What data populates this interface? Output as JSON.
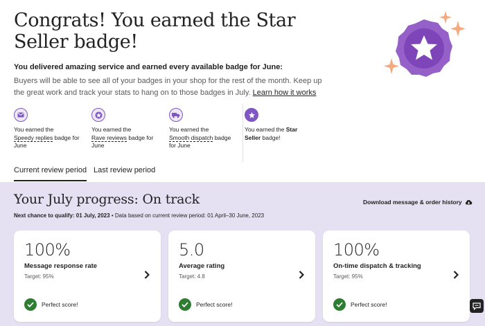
{
  "header": {
    "title": "Congrats! You earned the Star Seller badge!",
    "subhead": "You delivered amazing service and earned every available badge for June:",
    "body": "Buyers will be able to see all of your badges in your shop for the rest of the month. Keep up the great work and track your stats to hang on to those badges in July.",
    "learn_link": "Learn how it works"
  },
  "badges": [
    {
      "pre": "You earned the",
      "name": "Speedy replies",
      "post": "badge for June",
      "icon": "envelope-icon"
    },
    {
      "pre": "You earned the",
      "name": "Rave reviews",
      "post": "badge for June",
      "icon": "rave-reviews-icon"
    },
    {
      "pre": "You earned the",
      "name": "Smooth dispatch",
      "post": "badge for June",
      "icon": "truck-icon"
    }
  ],
  "star_badge": {
    "pre": "You earned the",
    "name": "Star Seller",
    "post": "badge!",
    "icon": "star-icon"
  },
  "tabs": [
    {
      "label": "Current review period",
      "active": true
    },
    {
      "label": "Last review period",
      "active": false
    }
  ],
  "progress": {
    "title": "Your July progress: On track",
    "download": "Download message & order history",
    "qualify_label": "Next chance to qualify: 01 July, 2023",
    "qualify_detail": "Data based on current review period: 01 April–30 June, 2023"
  },
  "cards": [
    {
      "value": "100%",
      "label": "Message response rate",
      "target": "Target: 95%",
      "score": "Perfect score!"
    },
    {
      "value": "5.0",
      "label": "Average rating",
      "target": "Target: 4.8",
      "score": "Perfect score!"
    },
    {
      "value": "100%",
      "label": "On-time dispatch & tracking",
      "target": "Target: 95%",
      "score": "Perfect score!"
    }
  ],
  "colors": {
    "accent_purple": "#7e57c2",
    "badge_purple": "#9560c8",
    "lavender_bg": "#e5e1f2",
    "success_green": "#2e7d32",
    "sparkle_orange": "#f5a97f"
  }
}
